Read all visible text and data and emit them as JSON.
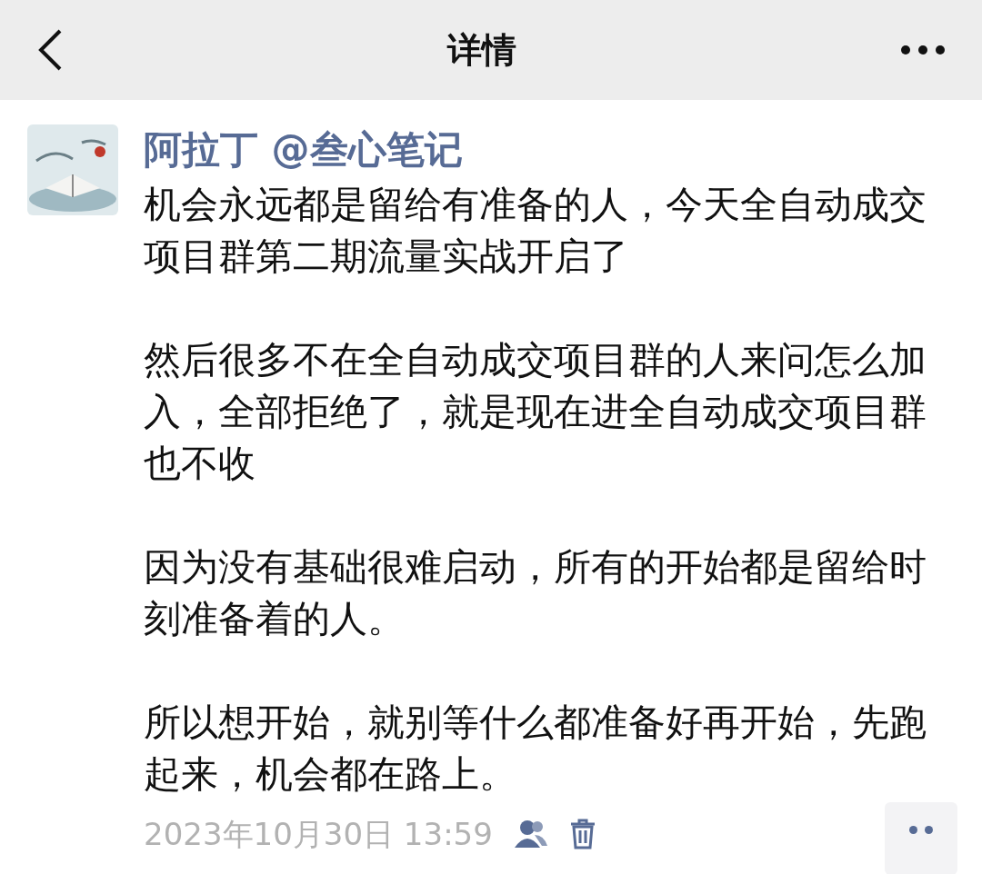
{
  "header": {
    "title": "详情"
  },
  "post": {
    "author": "阿拉丁 @叁心笔记",
    "paragraphs": [
      "机会永远都是留给有准备的人，今天全自动成交项目群第二期流量实战开启了",
      "然后很多不在全自动成交项目群的人来问怎么加入，全部拒绝了，就是现在进全自动成交项目群也不收",
      "因为没有基础很难启动，所有的开始都是留给时刻准备着的人。",
      "所以想开始，就别等什么都准备好再开始，先跑起来，机会都在路上。"
    ],
    "time": "2023年10月30日 13:59"
  }
}
